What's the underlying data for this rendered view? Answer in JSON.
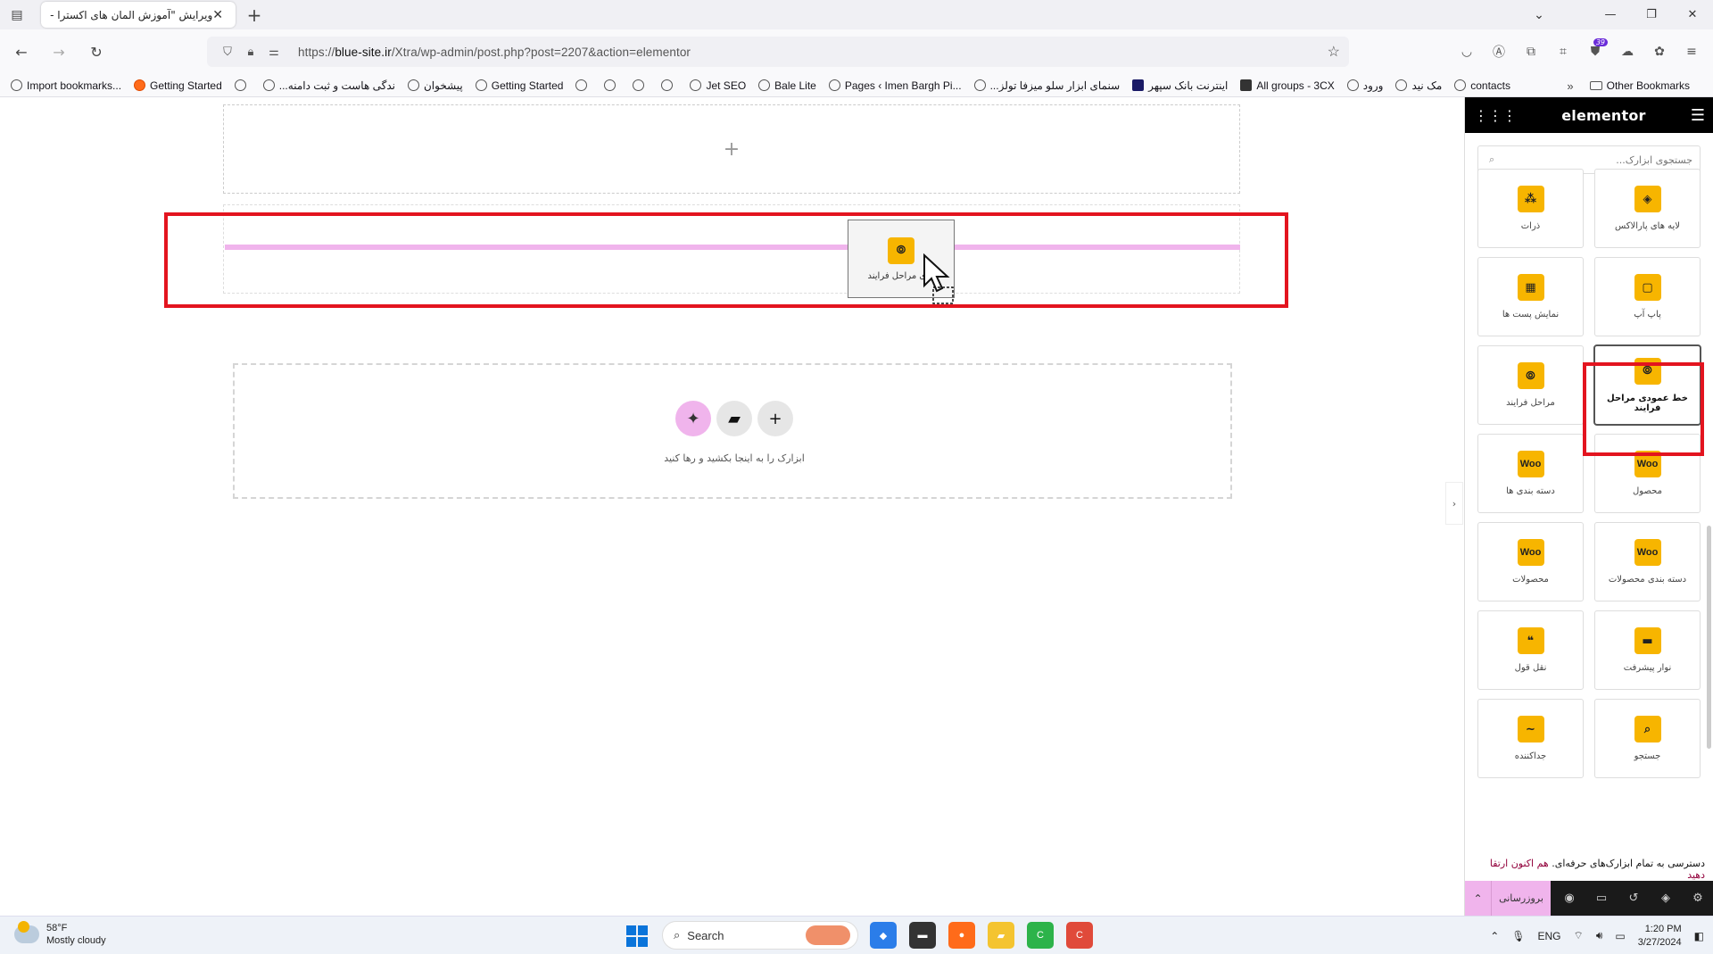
{
  "browser": {
    "tab_title": "ویرایش \"آموزش المان های اکسترا - ع",
    "url_prefix": "https://",
    "url_host": "blue-site.ir",
    "url_path": "/Xtra/wp-admin/post.php?post=2207&action=elementor",
    "extensions_badge": "39",
    "bookmarks": [
      {
        "label": "Import bookmarks...",
        "icon": "import-icon"
      },
      {
        "label": "Getting Started",
        "icon": "firefox-icon"
      },
      {
        "label": "",
        "icon": "bookmark-icon"
      },
      {
        "label": "...ندگی هاست و ثبت دامنه",
        "icon": "link-icon"
      },
      {
        "label": "پیشخوان",
        "icon": "globe-icon"
      },
      {
        "label": "Getting Started",
        "icon": "globe-icon"
      },
      {
        "label": "",
        "icon": "globe-icon"
      },
      {
        "label": "",
        "icon": "gmail-icon"
      },
      {
        "label": "",
        "icon": "globe-icon"
      },
      {
        "label": "",
        "icon": "globe-icon"
      },
      {
        "label": "Jet SEO",
        "icon": "rocket-icon"
      },
      {
        "label": "Bale Lite",
        "icon": "bale-icon"
      },
      {
        "label": "Pages ‹ Imen Bargh Pi...",
        "icon": "globe-icon"
      },
      {
        "label": "...سنمای ابزار سلو میزفا تولز",
        "icon": "globe-icon"
      },
      {
        "label": "اینترنت بانک سپهر",
        "icon": "bank-icon"
      },
      {
        "label": "All groups - 3CX",
        "icon": "3cx-icon"
      },
      {
        "label": "ورود",
        "icon": "globe-icon"
      },
      {
        "label": "مک نید",
        "icon": "globe-icon"
      },
      {
        "label": "contacts",
        "icon": "globe-icon"
      }
    ],
    "other_bookmarks": "Other Bookmarks"
  },
  "canvas": {
    "drag_ghost_label": "ودی مراحل فرایند",
    "add_section_hint": "ابزارک را به اینجا بکشید و رها کنید"
  },
  "panel": {
    "logo": "elementor",
    "search_placeholder": "جستجوی ابزارک...",
    "widgets": [
      {
        "label": "لایه های پارالاکس",
        "icon": "layers-icon"
      },
      {
        "label": "ذرات",
        "icon": "particles-icon"
      },
      {
        "label": "پاپ آپ",
        "icon": "popup-icon"
      },
      {
        "label": "نمایش پست ها",
        "icon": "posts-grid-icon"
      },
      {
        "label": "خط عمودی مراحل فرایند",
        "icon": "vertical-process-icon",
        "selected": true
      },
      {
        "label": "مراحل فرایند",
        "icon": "process-steps-icon"
      },
      {
        "label": "محصول",
        "icon": "woo-icon"
      },
      {
        "label": "دسته بندی ها",
        "icon": "woo-icon"
      },
      {
        "label": "دسته بندی محصولات",
        "icon": "woo-icon"
      },
      {
        "label": "محصولات",
        "icon": "woo-icon"
      },
      {
        "label": "نوار پیشرفت",
        "icon": "progress-bar-icon"
      },
      {
        "label": "نقل قول",
        "icon": "quote-icon"
      },
      {
        "label": "جستجو",
        "icon": "search-icon"
      },
      {
        "label": "جداکننده",
        "icon": "divider-icon"
      }
    ],
    "woo_text": "Woo",
    "promo_text": "دسترسی به تمام ابزارک‌های حرفه‌ای.",
    "promo_link": "هم اکنون ارتقا دهید",
    "publish_label": "بروزرسانی"
  },
  "taskbar": {
    "temperature": "58°F",
    "weather": "Mostly cloudy",
    "search_label": "Search",
    "language": "ENG",
    "time": "1:20 PM",
    "date": "3/27/2024"
  }
}
